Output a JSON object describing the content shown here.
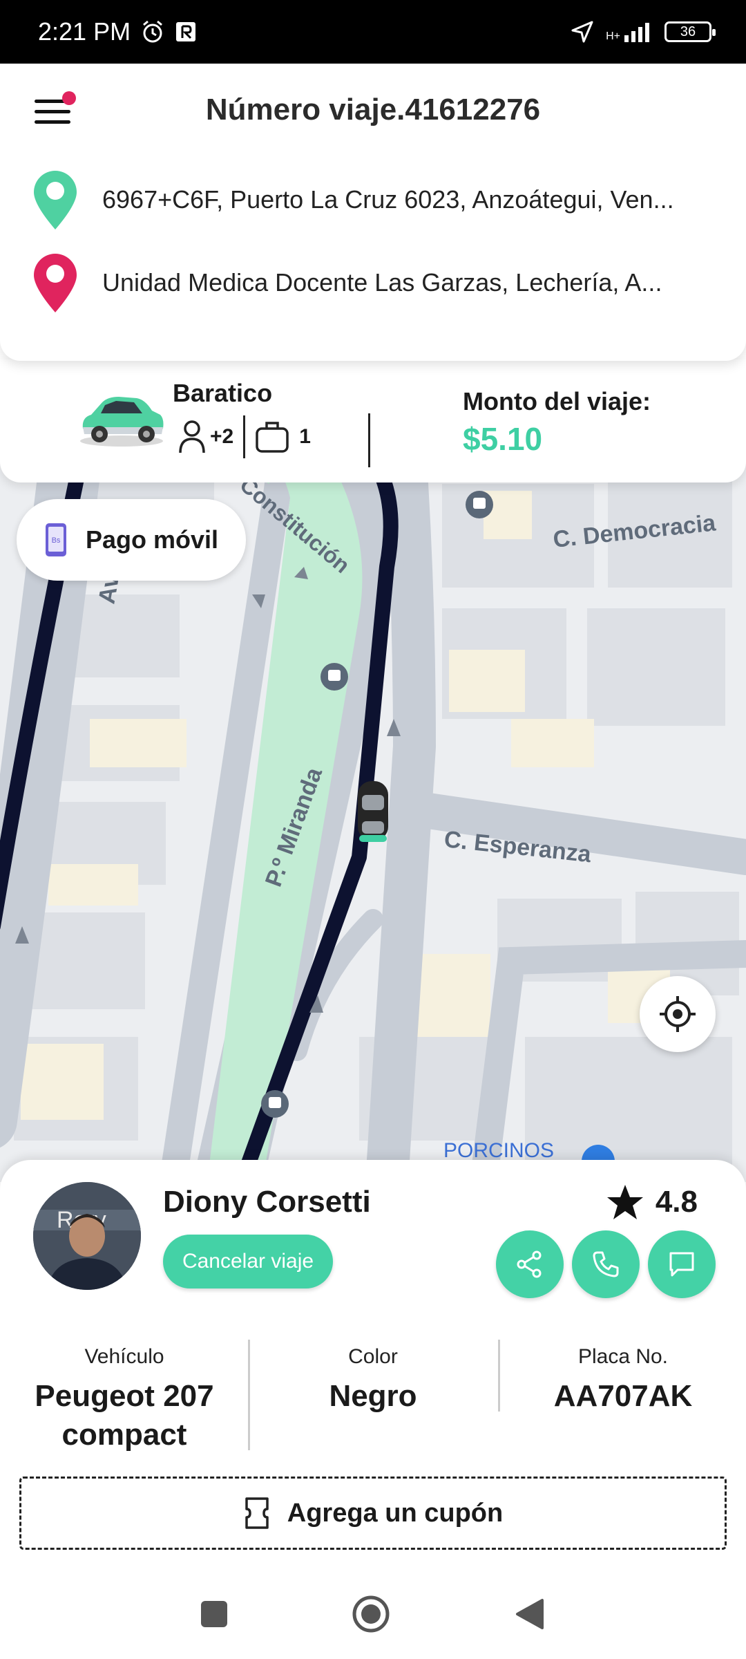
{
  "status_bar": {
    "time": "2:21 PM",
    "network": "H+",
    "battery": "36"
  },
  "header": {
    "title": "Número viaje.41612276",
    "origin": "6967+C6F, Puerto La Cruz 6023, Anzoátegui, Ven...",
    "destination": "Unidad Medica Docente Las Garzas, Lechería, A..."
  },
  "fare": {
    "service": "Baratico",
    "passengers": "+2",
    "luggage": "1",
    "label": "Monto del viaje:",
    "amount": "$5.10"
  },
  "payment": {
    "label": "Pago móvil",
    "icon_text": "Bs"
  },
  "map": {
    "streets": {
      "constitucion": "Constitución",
      "democracia": "C. Democracia",
      "miranda": "P.º Miranda",
      "esperanza": "C. Esperanza",
      "porcinos": "PORCINOS",
      "av": "Av"
    }
  },
  "driver": {
    "name": "Diony Corsetti",
    "rating": "4.8",
    "cancel_label": "Cancelar viaje",
    "avatar_text": "Rery"
  },
  "vehicle": {
    "vehicle_label": "Vehículo",
    "vehicle_value": "Peugeot 207 compact",
    "color_label": "Color",
    "color_value": "Negro",
    "plate_label": "Placa No.",
    "plate_value": "AA707AK"
  },
  "coupon": {
    "label": "Agrega un cupón"
  },
  "colors": {
    "accent": "#44d2a6",
    "origin_pin": "#4fd1a1",
    "destination_pin": "#e0245e",
    "route": "#0d1230"
  },
  "icons": [
    "menu-icon",
    "origin-pin-icon",
    "destination-pin-icon",
    "car-icon",
    "person-icon",
    "luggage-icon",
    "mobile-payment-icon",
    "locate-icon",
    "star-icon",
    "share-icon",
    "phone-icon",
    "chat-icon",
    "coupon-icon"
  ]
}
